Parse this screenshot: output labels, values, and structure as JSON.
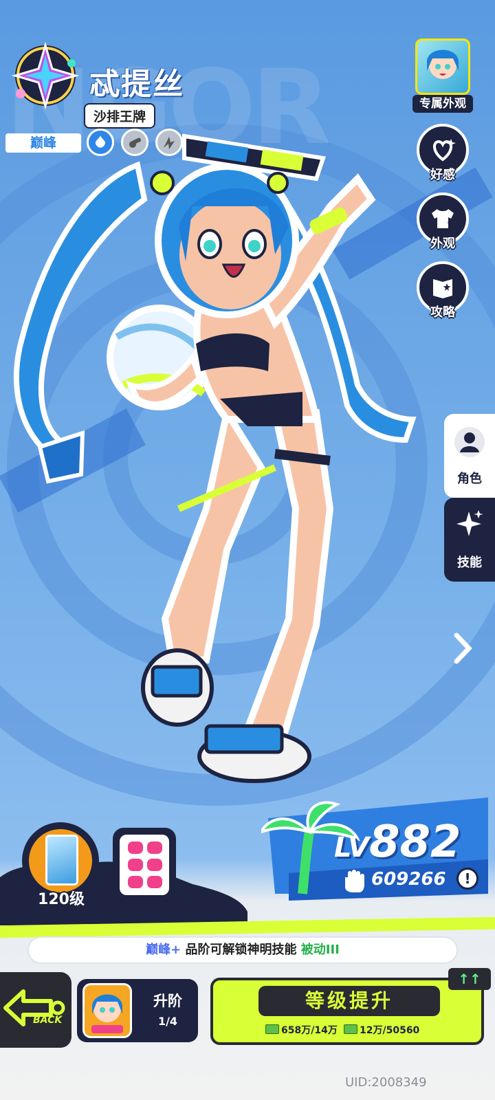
{
  "character": {
    "name": "忒提丝",
    "title_tag": "沙排王牌",
    "tier": "巅峰"
  },
  "right_menu": {
    "skin_label": "专属外观",
    "buttons": [
      "好感",
      "外观",
      "攻略"
    ]
  },
  "side_tabs": {
    "active": "角色",
    "inactive": "技能"
  },
  "level": {
    "prefix": "LV",
    "value": "882",
    "power": "609266"
  },
  "portrait": {
    "level_label": "120级"
  },
  "notice": {
    "part_a": "巅峰+",
    "part_b": " 品阶可解锁神明技能 ",
    "part_c": "被动III"
  },
  "bottom": {
    "back_label": "BACK",
    "rank_up_title": "升阶",
    "rank_up_progress": "1/4",
    "level_up_label": "等级提升",
    "cost_1": "658万/14万",
    "cost_2": "12万/50560",
    "up_badge": "↑↑"
  },
  "uid": "UID:2008349",
  "colors": {
    "lime": "#d9ff36",
    "navy": "#1d2340",
    "sky": "#6aa6e4"
  }
}
